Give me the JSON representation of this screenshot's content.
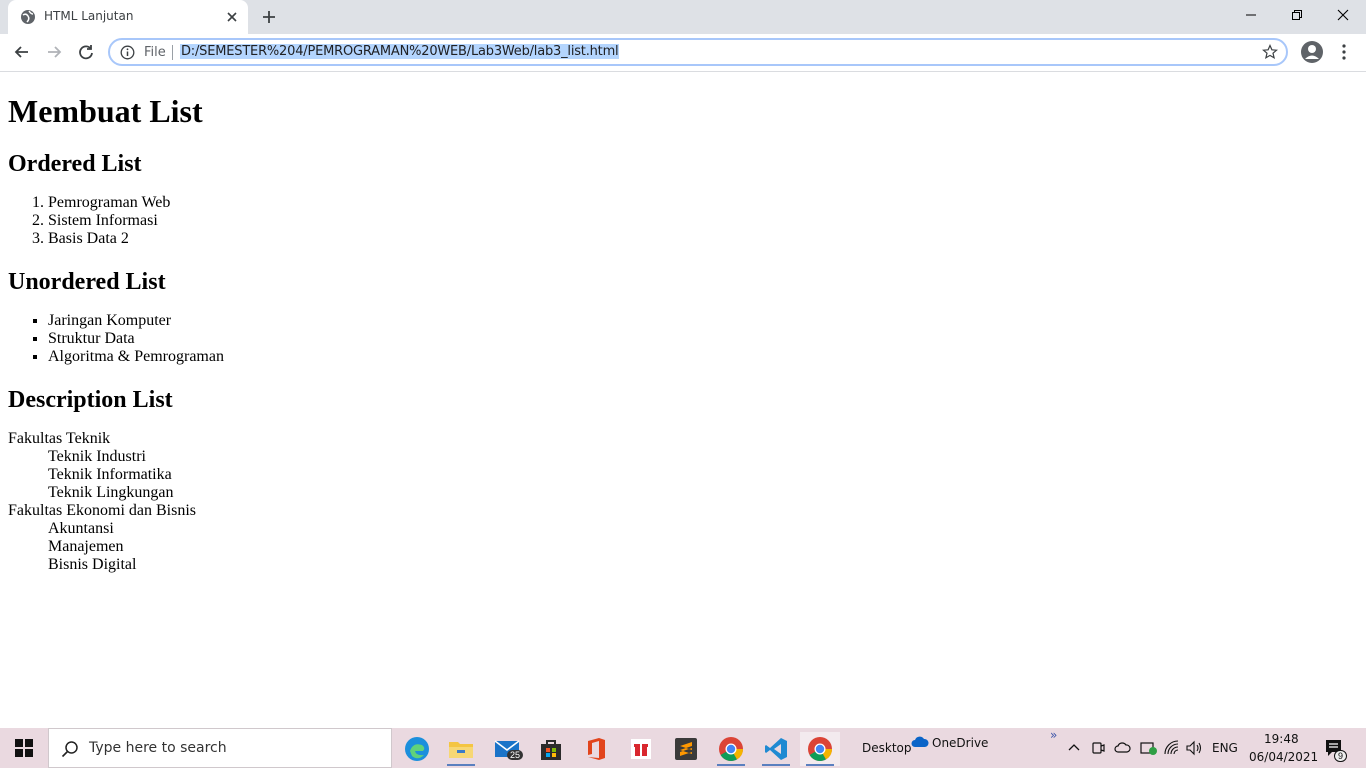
{
  "browser": {
    "tab_title": "HTML Lanjutan",
    "omnibox_scheme": "File",
    "url": "D:/SEMESTER%204/PEMROGRAMAN%20WEB/Lab3Web/lab3_list.html"
  },
  "page": {
    "h1": "Membuat List",
    "ordered": {
      "heading": "Ordered List",
      "items": [
        "Pemrograman Web",
        "Sistem Informasi",
        "Basis Data 2"
      ]
    },
    "unordered": {
      "heading": "Unordered List",
      "items": [
        "Jaringan Komputer",
        "Struktur Data",
        "Algoritma & Pemrograman"
      ]
    },
    "description": {
      "heading": "Description List",
      "groups": [
        {
          "term": "Fakultas Teknik",
          "defs": [
            "Teknik Industri",
            "Teknik Informatika",
            "Teknik Lingkungan"
          ]
        },
        {
          "term": "Fakultas Ekonomi dan Bisnis",
          "defs": [
            "Akuntansi",
            "Manajemen",
            "Bisnis Digital"
          ]
        }
      ]
    }
  },
  "taskbar": {
    "search_placeholder": "Type here to search",
    "mail_badge": "25",
    "desktop_label": "Desktop",
    "onedrive_label": "OneDrive",
    "lang": "ENG",
    "time": "19:48",
    "date": "06/04/2021",
    "notif_count": "9"
  },
  "colors": {
    "accent": "#1a73e8",
    "tabstrip": "#dee1e6",
    "taskbar": "#ead9e0",
    "selection": "#b4d5fe"
  }
}
